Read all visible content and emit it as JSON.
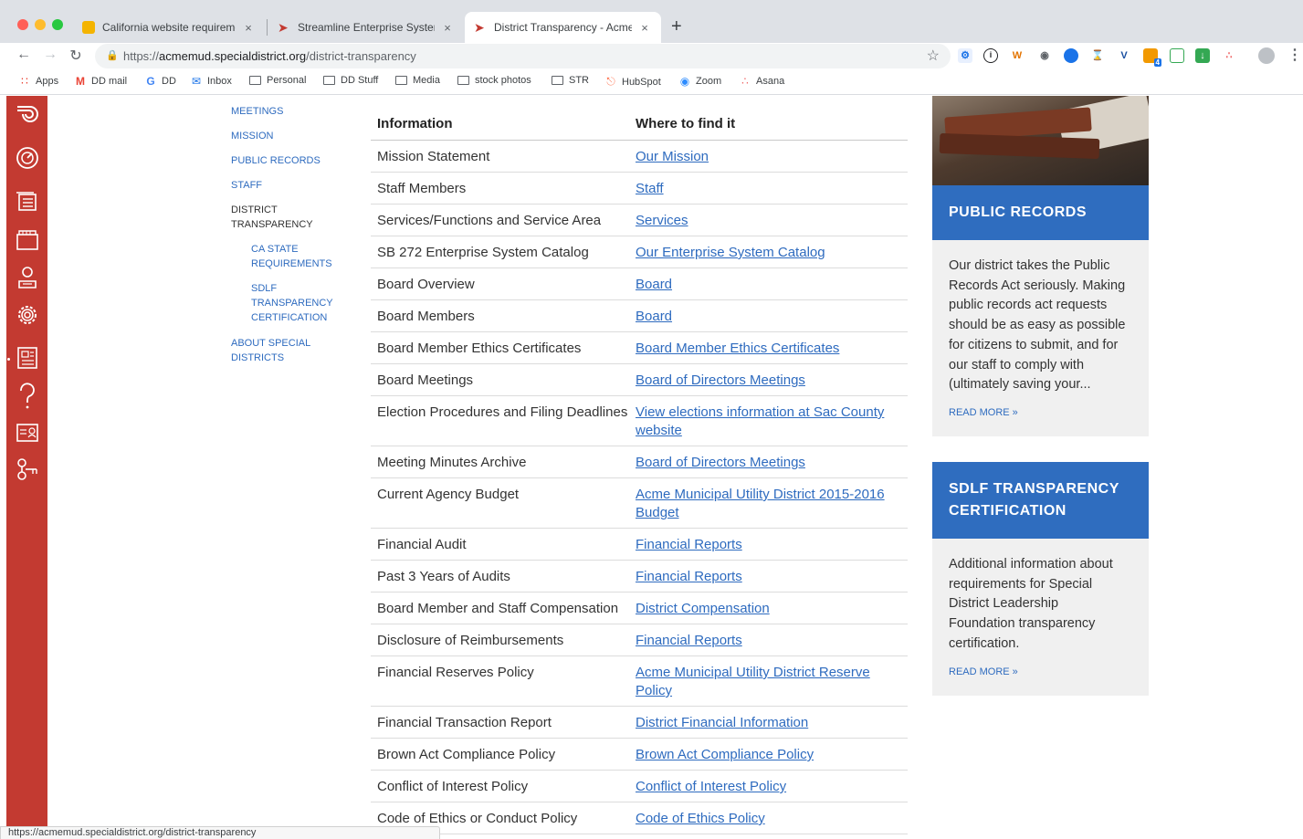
{
  "browser": {
    "tabs": [
      {
        "title": "California website requirements",
        "active": false,
        "favicon_color": "#f4b400"
      },
      {
        "title": "Streamline Enterprise System Ca",
        "active": false,
        "favicon_color": "#c33a31"
      },
      {
        "title": "District Transparency - Acme Mu",
        "active": true,
        "favicon_color": "#c33a31"
      }
    ],
    "close_glyph": "×",
    "new_tab_glyph": "+",
    "url_scheme": "https://",
    "url_host": "acmemud.specialdistrict.org",
    "url_path": "/district-transparency",
    "bookmarks": [
      {
        "label": "Apps",
        "icon": "apps-grid-icon"
      },
      {
        "label": "DD mail",
        "icon": "gmail-icon"
      },
      {
        "label": "DD",
        "icon": "google-icon"
      },
      {
        "label": "Inbox",
        "icon": "inbox-icon"
      },
      {
        "label": "Personal",
        "icon": "folder-icon"
      },
      {
        "label": "DD Stuff",
        "icon": "folder-icon"
      },
      {
        "label": "Media",
        "icon": "folder-icon"
      },
      {
        "label": "stock photos",
        "icon": "folder-icon"
      },
      {
        "label": "STR",
        "icon": "folder-icon"
      },
      {
        "label": "HubSpot",
        "icon": "hubspot-icon"
      },
      {
        "label": "Zoom",
        "icon": "zoom-icon"
      },
      {
        "label": "Asana",
        "icon": "asana-icon"
      }
    ],
    "extension_badge": "4",
    "status_url": "https://acmemud.specialdistrict.org/district-transparency"
  },
  "subnav": {
    "items": [
      {
        "label": "MEETINGS"
      },
      {
        "label": "MISSION"
      },
      {
        "label": "PUBLIC RECORDS"
      },
      {
        "label": "STAFF"
      },
      {
        "label": "DISTRICT TRANSPARENCY",
        "current": true
      },
      {
        "label": "CA STATE REQUIREMENTS",
        "sub": true
      },
      {
        "label": "SDLF TRANSPARENCY CERTIFICATION",
        "sub": true
      },
      {
        "label": "ABOUT SPECIAL DISTRICTS"
      }
    ]
  },
  "table": {
    "headers": [
      "Information",
      "Where to find it"
    ],
    "rows": [
      {
        "info": "Mission Statement",
        "link": "Our Mission"
      },
      {
        "info": "Staff Members",
        "link": "Staff"
      },
      {
        "info": "Services/Functions and Service Area",
        "link": "Services"
      },
      {
        "info": "SB 272 Enterprise System Catalog",
        "link": "Our Enterprise System Catalog"
      },
      {
        "info": "Board Overview",
        "link": "Board"
      },
      {
        "info": "Board Members",
        "link": "Board"
      },
      {
        "info": "Board Member Ethics Certificates",
        "link": "Board Member Ethics Certificates"
      },
      {
        "info": "Board Meetings",
        "link": "Board of Directors Meetings"
      },
      {
        "info": "Election Procedures and Filing Deadlines",
        "link": "View elections information at Sac County website"
      },
      {
        "info": "Meeting Minutes Archive",
        "link": "Board of Directors Meetings"
      },
      {
        "info": "Current Agency Budget",
        "link": "Acme Municipal Utility District 2015-2016 Budget"
      },
      {
        "info": "Financial Audit",
        "link": "Financial Reports"
      },
      {
        "info": "Past 3 Years of Audits",
        "link": "Financial Reports"
      },
      {
        "info": "Board Member and Staff Compensation",
        "link": "District Compensation"
      },
      {
        "info": "Disclosure of Reimbursements",
        "link": "Financial Reports"
      },
      {
        "info": "Financial Reserves Policy",
        "link": "Acme Municipal Utility District Reserve Policy"
      },
      {
        "info": "Financial Transaction Report",
        "link": "District Financial Information"
      },
      {
        "info": "Brown Act Compliance Policy",
        "link": "Brown Act Compliance Policy"
      },
      {
        "info": "Conflict of Interest Policy",
        "link": "Conflict of Interest Policy"
      },
      {
        "info": "Code of Ethics or Conduct Policy",
        "link": "Code of Ethics Policy"
      }
    ]
  },
  "sidebar": {
    "public_records": {
      "title": "PUBLIC RECORDS",
      "body": "Our district takes the Public Records Act seriously. Making public records act requests should be as easy as possible for citizens to submit, and for our staff to comply with (ultimately saving your...",
      "more": "READ MORE »"
    },
    "sdlf": {
      "title": "SDLF TRANSPARENCY CERTIFICATION",
      "body": "Additional information about requirements for Special District Leadership Foundation transparency certification.",
      "more": "READ MORE »"
    }
  },
  "colors": {
    "brand_red": "#c33a31",
    "link_blue": "#2e6bbf",
    "panel_blue": "#2f6dbf"
  }
}
